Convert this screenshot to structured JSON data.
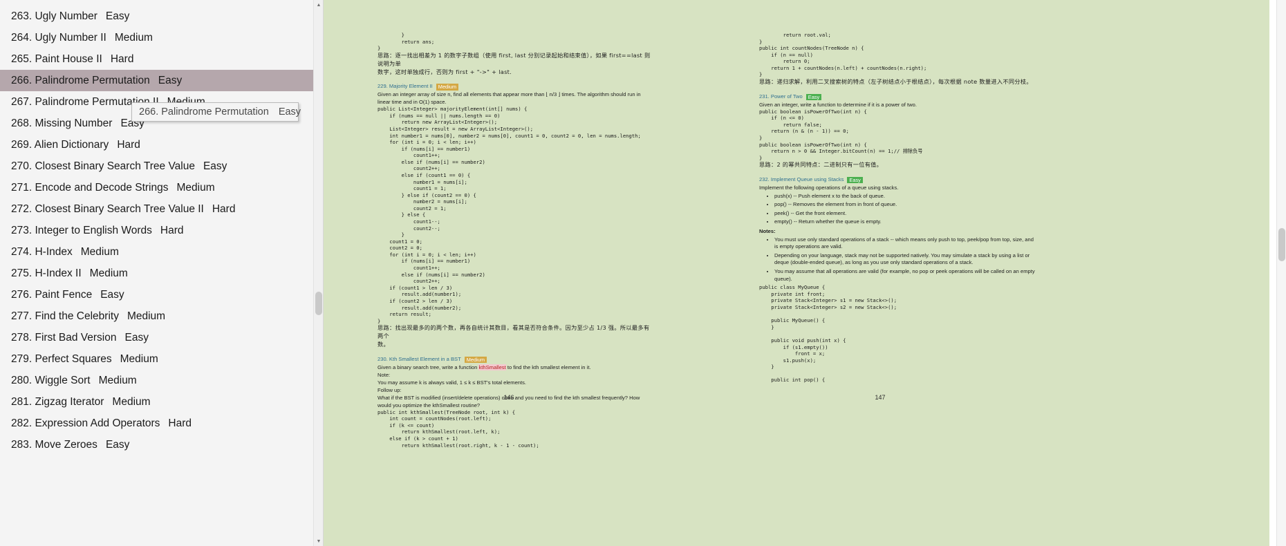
{
  "sidebar": {
    "items": [
      {
        "num": "263.",
        "title": "Ugly Number",
        "difficulty": "Easy",
        "selected": false
      },
      {
        "num": "264.",
        "title": "Ugly Number II",
        "difficulty": "Medium",
        "selected": false
      },
      {
        "num": "265.",
        "title": "Paint House II",
        "difficulty": "Hard",
        "selected": false
      },
      {
        "num": "266.",
        "title": "Palindrome Permutation",
        "difficulty": "Easy",
        "selected": true
      },
      {
        "num": "267.",
        "title": "Palindrome Permutation II",
        "difficulty": "Medium",
        "selected": false
      },
      {
        "num": "268.",
        "title": "Missing Number",
        "difficulty": "Easy",
        "selected": false
      },
      {
        "num": "269.",
        "title": "Alien Dictionary",
        "difficulty": "Hard",
        "selected": false
      },
      {
        "num": "270.",
        "title": "Closest Binary Search Tree Value",
        "difficulty": "Easy",
        "selected": false
      },
      {
        "num": "271.",
        "title": "Encode and Decode Strings",
        "difficulty": "Medium",
        "selected": false
      },
      {
        "num": "272.",
        "title": "Closest Binary Search Tree Value II",
        "difficulty": "Hard",
        "selected": false
      },
      {
        "num": "273.",
        "title": "Integer to English Words",
        "difficulty": "Hard",
        "selected": false
      },
      {
        "num": "274.",
        "title": "H-Index",
        "difficulty": "Medium",
        "selected": false
      },
      {
        "num": "275.",
        "title": "H-Index II",
        "difficulty": "Medium",
        "selected": false
      },
      {
        "num": "276.",
        "title": "Paint Fence",
        "difficulty": "Easy",
        "selected": false
      },
      {
        "num": "277.",
        "title": "Find the Celebrity",
        "difficulty": "Medium",
        "selected": false
      },
      {
        "num": "278.",
        "title": "First Bad Version",
        "difficulty": "Easy",
        "selected": false
      },
      {
        "num": "279.",
        "title": "Perfect Squares",
        "difficulty": "Medium",
        "selected": false
      },
      {
        "num": "280.",
        "title": "Wiggle Sort",
        "difficulty": "Medium",
        "selected": false
      },
      {
        "num": "281.",
        "title": "Zigzag Iterator",
        "difficulty": "Medium",
        "selected": false
      },
      {
        "num": "282.",
        "title": "Expression Add Operators",
        "difficulty": "Hard",
        "selected": false
      },
      {
        "num": "283.",
        "title": "Move Zeroes",
        "difficulty": "Easy",
        "selected": false
      }
    ],
    "scrollbar": {
      "up_arrow": "▲",
      "down_arrow": "▼"
    }
  },
  "tooltip": {
    "title": "266. Palindrome Permutation",
    "difficulty": "Easy"
  },
  "document": {
    "page_left_number": "146",
    "page_right_number": "147",
    "left_column": {
      "tail_code_1": "        }\n        return ans;\n}",
      "note_1": "思路：逐一找出相差为 1 的数字子数组（使用 first, last 分别记录起始和结束值），如果 first==last 则说明为单",
      "note_1b": "数字，这时单独成行，否则为 first + \"->\" + last.",
      "section_229": {
        "title": "229. Majority Element II",
        "badge": "Medium",
        "desc_1": "Given an integer array of size n, find all elements that appear more than ⌊ n/3 ⌋ times. The algorithm should run in",
        "desc_2": "linear time and in O(1) space.",
        "code": "public List<Integer> majorityElement(int[] nums) {\n    if (nums == null || nums.length == 0)\n        return new ArrayList<Integer>();\n    List<Integer> result = new ArrayList<Integer>();\n    int number1 = nums[0], number2 = nums[0], count1 = 0, count2 = 0, len = nums.length;\n    for (int i = 0; i < len; i++)\n        if (nums[i] == number1)\n            count1++;\n        else if (nums[i] == number2)\n            count2++;\n        else if (count1 == 0) {\n            number1 = nums[i];\n            count1 = 1;\n        } else if (count2 == 0) {\n            number2 = nums[i];\n            count2 = 1;\n        } else {\n            count1--;\n            count2--;\n        }\n    count1 = 0;\n    count2 = 0;\n    for (int i = 0; i < len; i++)\n        if (nums[i] == number1)\n            count1++;\n        else if (nums[i] == number2)\n            count2++;\n    if (count1 > len / 3)\n        result.add(number1);\n    if (count2 > len / 3)\n        result.add(number2);\n    return result;\n}",
        "note": "思路：找出现最多的的两个数，再各自统计其数目，看其是否符合条件。因为至少占 1/3 强。所以最多有两个",
        "note_b": "数。"
      },
      "section_230": {
        "title": "230. Kth Smallest Element in a BST",
        "badge": "Medium",
        "desc_1_pre": "Given a binary search tree, write a function ",
        "desc_1_code": "kthSmallest",
        "desc_1_post": " to find the kth smallest element in it.",
        "note_label": "Note:",
        "note_text": "You may assume k is always valid, 1 ≤ k ≤ BST's total elements.",
        "followup_label": "Follow up:",
        "followup_1": "What if the BST is modified (insert/delete operations) often and you need to find the kth smallest frequently? How",
        "followup_2": "would you optimize the kthSmallest routine?",
        "code": "public int kthSmallest(TreeNode root, int k) {\n    int count = countNodes(root.left);\n    if (k <= count)\n        return kthSmallest(root.left, k);\n    else if (k > count + 1)\n        return kthSmallest(root.right, k - 1 - count);"
      }
    },
    "right_column": {
      "tail_code_1": "        return root.val;\n}",
      "code_countnodes": "public int countNodes(TreeNode n) {\n    if (n == null)\n        return 0;\n    return 1 + countNodes(n.left) + countNodes(n.right);\n}",
      "note_1": "思路：递归求解，利用二叉搜索树的特点（左子树结点小于根结点），每次根据 note 数量进入不同分枝。",
      "section_231": {
        "title": "231. Power of Two",
        "badge": "Easy",
        "desc_1": "Given an integer, write a function to determine if it is a power of two.",
        "code": "public boolean isPowerOfTwo(int n) {\n    if (n <= 0)\n        return false;\n    return (n & (n - 1)) == 0;\n}\npublic boolean isPowerOfTwo(int n) {\n    return n > 0 && Integer.bitCount(n) == 1;// 排除负号\n}",
        "note": "思路：2 的幂共同特点：二进制只有一位有值。"
      },
      "section_232": {
        "title": "232. Implement Queue using Stacks",
        "badge": "Easy",
        "desc_1": "Implement the following operations of a queue using stacks.",
        "ops": [
          "push(x) -- Push element x to the back of queue.",
          "pop() -- Removes the element from in front of queue.",
          "peek() -- Get the front element.",
          "empty() -- Return whether the queue is empty."
        ],
        "notes_label": "Notes:",
        "notes": [
          "You must use only standard operations of a stack -- which means only push to top, peek/pop from top, size, and is empty operations are valid.",
          "Depending on your language, stack may not be supported natively. You may simulate a stack by using a list or deque (double-ended queue), as long as you use only standard operations of a stack.",
          "You may assume that all operations are valid (for example, no pop or peek operations will be called on an empty queue)."
        ],
        "code": "public class MyQueue {\n    private int front;\n    private Stack<Integer> s1 = new Stack<>();\n    private Stack<Integer> s2 = new Stack<>();\n\n    public MyQueue() {\n    }\n\n    public void push(int x) {\n        if (s1.empty())\n            front = x;\n        s1.push(x);\n    }\n\n    public int pop() {"
      }
    }
  }
}
